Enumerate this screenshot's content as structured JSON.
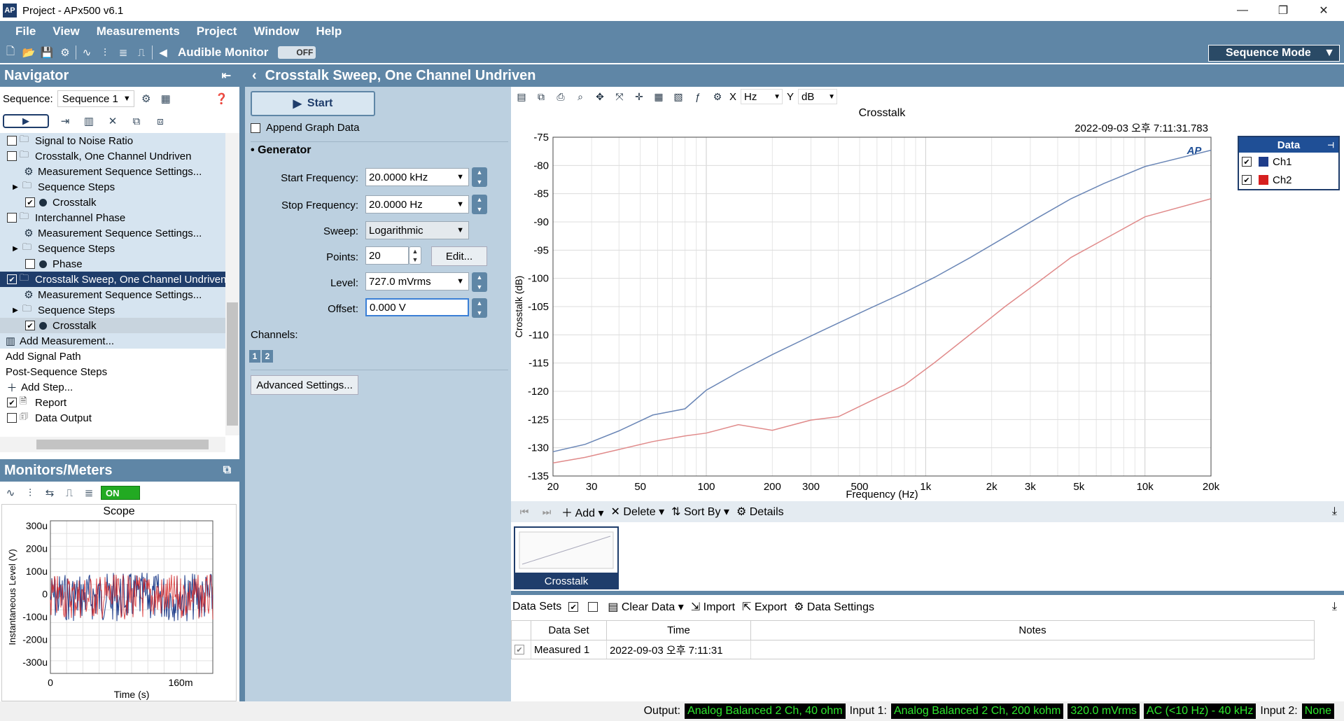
{
  "window": {
    "title": "Project - APx500 v6.1",
    "app_icon": "AP",
    "minimize": "—",
    "restore": "❐",
    "close": "✕"
  },
  "menu": [
    "File",
    "View",
    "Measurements",
    "Project",
    "Window",
    "Help"
  ],
  "toolbar": {
    "audible_monitor": "Audible Monitor",
    "audible_state": "OFF",
    "mode": "Sequence Mode"
  },
  "navigator": {
    "title": "Navigator",
    "sequence_label": "Sequence:",
    "sequence_value": "Sequence 1",
    "tree": [
      {
        "label": "Signal to Noise Ratio"
      },
      {
        "label": "Crosstalk, One Channel Undriven"
      },
      {
        "label": "Measurement Sequence Settings..."
      },
      {
        "label": "Sequence Steps"
      },
      {
        "label": "Crosstalk"
      },
      {
        "label": "Interchannel Phase"
      },
      {
        "label": "Measurement Sequence Settings..."
      },
      {
        "label": "Sequence Steps"
      },
      {
        "label": "Phase"
      },
      {
        "label": "Crosstalk Sweep, One Channel Undriven"
      },
      {
        "label": "Measurement Sequence Settings..."
      },
      {
        "label": "Sequence Steps"
      },
      {
        "label": "Crosstalk"
      },
      {
        "label": "Add Measurement..."
      },
      {
        "label": "Add Signal Path"
      },
      {
        "label": "Post-Sequence Steps"
      },
      {
        "label": "Add Step..."
      },
      {
        "label": "Report"
      },
      {
        "label": "Data Output"
      }
    ]
  },
  "monitors": {
    "title": "Monitors/Meters",
    "on_label": "ON",
    "scope": {
      "title": "Scope",
      "ylabel": "Instantaneous Level (V)",
      "xlabel": "Time (s)",
      "yticks": [
        "300u",
        "200u",
        "100u",
        "0",
        "-100u",
        "-200u",
        "-300u"
      ],
      "xticks": [
        "0",
        "160m"
      ]
    }
  },
  "measurement": {
    "title": "Crosstalk Sweep, One Channel Undriven",
    "start_label": "Start",
    "append_label": "Append Graph Data",
    "generator_label": "Generator",
    "fields": {
      "start_freq_label": "Start Frequency:",
      "start_freq": "20.0000 kHz",
      "stop_freq_label": "Stop Frequency:",
      "stop_freq": "20.0000 Hz",
      "sweep_label": "Sweep:",
      "sweep": "Logarithmic",
      "points_label": "Points:",
      "points": "20",
      "edit_label": "Edit...",
      "level_label": "Level:",
      "level": "727.0 mVrms",
      "offset_label": "Offset:",
      "offset": "0.000 V"
    },
    "channels_label": "Channels:",
    "channels": [
      "1",
      "2"
    ],
    "advanced_label": "Advanced Settings..."
  },
  "graph": {
    "x_unit_label": "X",
    "x_unit": "Hz",
    "y_unit_label": "Y",
    "y_unit": "dB",
    "timestamp": "2022-09-03 오후 7:11:31.783",
    "legend": {
      "title": "Data",
      "items": [
        {
          "label": "Ch1",
          "color": "#1f3d8a"
        },
        {
          "label": "Ch2",
          "color": "#d62020"
        }
      ]
    }
  },
  "chart_data": {
    "type": "line",
    "title": "Crosstalk",
    "xlabel": "Frequency (Hz)",
    "ylabel": "Crosstalk (dB)",
    "xscale": "log",
    "xlim": [
      20,
      20000
    ],
    "ylim": [
      -135,
      -75
    ],
    "xticks": [
      "20",
      "30",
      "50",
      "100",
      "200",
      "300",
      "500",
      "1k",
      "2k",
      "3k",
      "5k",
      "10k",
      "20k"
    ],
    "yticks": [
      "-75",
      "-80",
      "-85",
      "-90",
      "-95",
      "-100",
      "-105",
      "-110",
      "-115",
      "-120",
      "-125",
      "-130",
      "-135"
    ],
    "grid": true,
    "legend": "top-right",
    "series": [
      {
        "name": "Ch1",
        "color": "#6a86b6",
        "x": [
          20,
          28,
          40,
          57,
          80,
          100,
          140,
          200,
          300,
          400,
          550,
          800,
          1100,
          1600,
          2300,
          3200,
          4600,
          6500,
          10000,
          20000
        ],
        "y": [
          -130.7,
          -129.4,
          -127.0,
          -124.2,
          -123.1,
          -119.8,
          -116.6,
          -113.5,
          -110.2,
          -107.9,
          -105.4,
          -102.5,
          -99.8,
          -96.3,
          -92.7,
          -89.4,
          -85.9,
          -83.2,
          -80.2,
          -77.3
        ]
      },
      {
        "name": "Ch2",
        "color": "#e08a8a",
        "x": [
          20,
          28,
          40,
          57,
          80,
          100,
          140,
          200,
          300,
          400,
          550,
          800,
          1100,
          1600,
          2300,
          3200,
          4600,
          6500,
          10000,
          20000
        ],
        "y": [
          -132.7,
          -131.7,
          -130.3,
          -128.9,
          -127.9,
          -127.4,
          -125.9,
          -126.9,
          -125.1,
          -124.5,
          -121.9,
          -118.9,
          -114.9,
          -109.9,
          -105.0,
          -100.9,
          -96.3,
          -93.1,
          -89.1,
          -85.9
        ]
      }
    ]
  },
  "thumbs": {
    "add": "Add",
    "delete": "Delete",
    "sort": "Sort By",
    "details": "Details",
    "caption": "Crosstalk"
  },
  "datasets": {
    "label": "Data Sets",
    "clear": "Clear Data",
    "import": "Import",
    "export": "Export",
    "settings": "Data Settings",
    "headers": [
      "Data Set",
      "Time",
      "Notes"
    ],
    "rows": [
      {
        "name": "Measured 1",
        "time": "2022-09-03 오후 7:11:31",
        "notes": ""
      }
    ]
  },
  "status": {
    "output_label": "Output:",
    "output": "Analog Balanced 2 Ch, 40 ohm",
    "input1_label": "Input 1:",
    "input1": "Analog Balanced 2 Ch, 200 kohm",
    "input1_level": "320.0 mVrms",
    "input1_filter": "AC (<10 Hz) - 40 kHz",
    "input2_label": "Input 2:",
    "input2": "None"
  }
}
